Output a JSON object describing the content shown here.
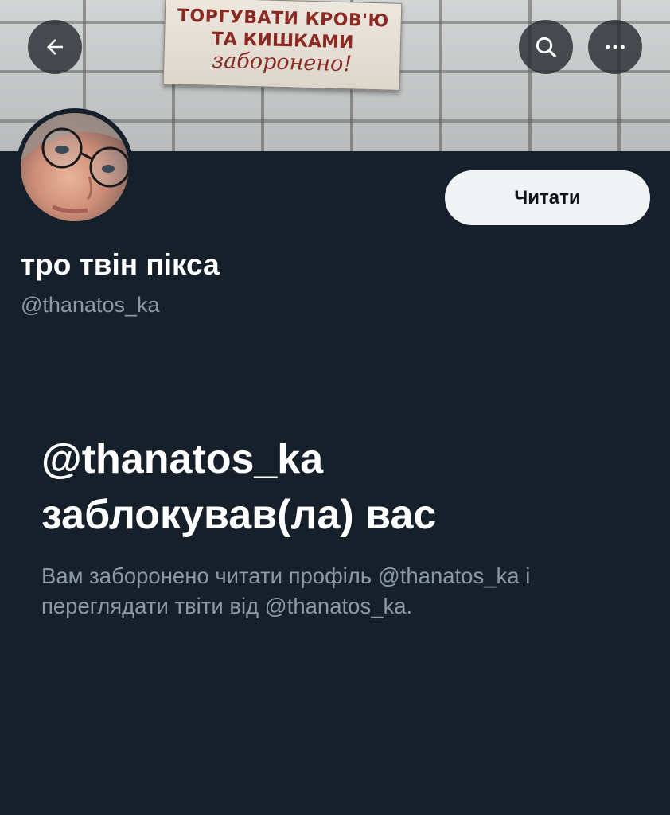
{
  "banner": {
    "sign": {
      "line1": "ТОРГУВАТИ КРОВ'Ю",
      "line2": "ТА КИШКАМИ",
      "line3": "заборонено!"
    }
  },
  "header": {
    "back_icon": "arrow-left-icon",
    "search_icon": "search-icon",
    "more_icon": "more-horizontal-icon"
  },
  "profile": {
    "display_name": "тро твін пікса",
    "handle": "@thanatos_ka",
    "follow_label": "Читати"
  },
  "blocked": {
    "title_line1": "@thanatos_ka",
    "title_line2": "заблокував(ла) вас",
    "description": "Вам заборонено читати профіль @thanatos_ka і переглядати твіти від @thanatos_ka."
  },
  "colors": {
    "background": "#15202b",
    "primary_text": "#ffffff",
    "secondary_text": "#8b98a5",
    "button_bg": "#eff3f4"
  }
}
